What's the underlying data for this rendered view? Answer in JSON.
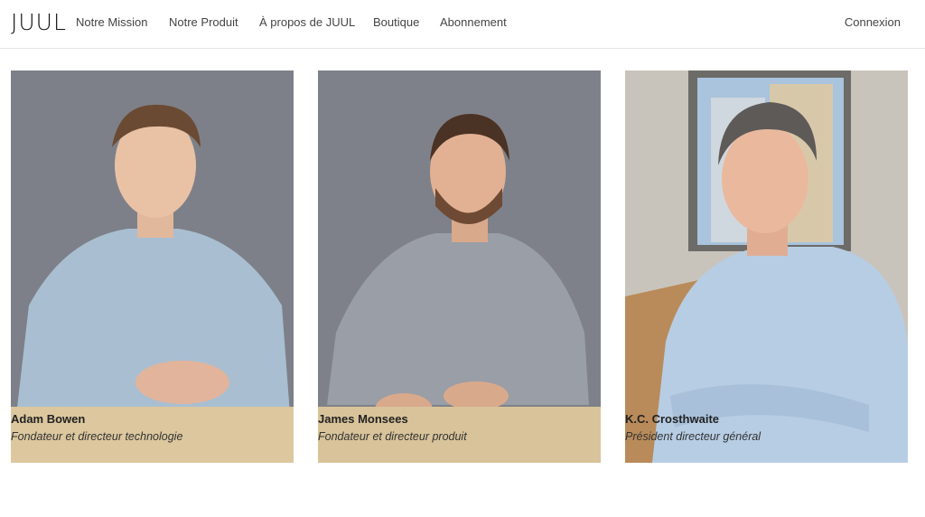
{
  "brand": {
    "logo_text": "JUUL"
  },
  "nav": {
    "items": [
      "Notre Mission",
      "Notre Produit",
      "À propos de JUUL",
      "Boutique",
      "Abonnement"
    ],
    "login_label": "Connexion"
  },
  "team": [
    {
      "name": "Adam Bowen",
      "title": "Fondateur et directeur technologie"
    },
    {
      "name": "James Monsees",
      "title": "Fondateur et directeur produit"
    },
    {
      "name": "K.C. Crosthwaite",
      "title": "Président directeur général"
    }
  ],
  "colors": {
    "photo_backdrop": "#7d8088",
    "table_wood": "#dcc79e",
    "shirt_denim": "#a9bfd1",
    "shirt_gray": "#9a9ea6",
    "shirt_check": "#b7cde4"
  }
}
